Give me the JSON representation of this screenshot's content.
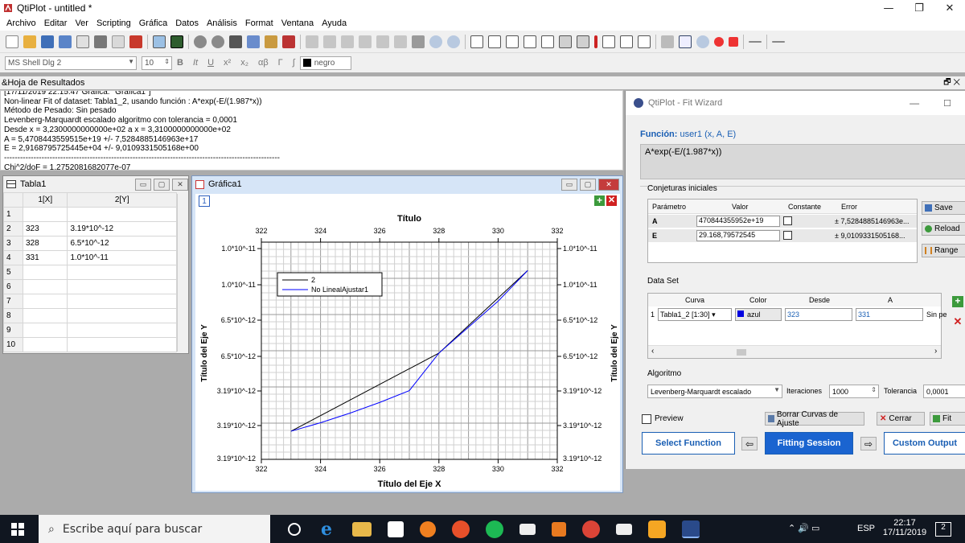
{
  "window": {
    "title": "QtiPlot - untitled *"
  },
  "menu": [
    "Archivo",
    "Editar",
    "Ver",
    "Scripting",
    "Gráfica",
    "Datos",
    "Análisis",
    "Format",
    "Ventana",
    "Ayuda"
  ],
  "format_bar": {
    "font": "MS Shell Dlg 2",
    "size": "10",
    "bold": "B",
    "italic": "It",
    "underline": "U",
    "superscript": "x²",
    "subscript": "x₂",
    "greek": "αβ",
    "color_label": "negro"
  },
  "results": {
    "header": "&Hoja de Resultados",
    "lines": [
      "[17/11/2019 22:15:47          Gráfica: ''Gráfica1'']",
      "Non-linear Fit of dataset: Tabla1_2, usando función : A*exp(-E/(1.987*x))",
      "Método de Pesado: Sin pesado",
      "Levenberg-Marquardt escalado algoritmo con tolerancia = 0,0001",
      "Desde x = 3,2300000000000e+02 a x = 3,3100000000000e+02",
      "A = 5,4708443559515e+19 +/- 7,5284885146963e+17",
      "E = 2,9168795725445e+04 +/- 9,0109331505168e+00",
      "-------------------------------------------------------------------------------------------------------",
      "Chi^2/doF = 1,2752081682077e-07"
    ]
  },
  "table": {
    "title": "Tabla1",
    "headers": [
      "1[X]",
      "2[Y]"
    ],
    "rows": [
      {
        "n": "1",
        "x": "",
        "y": ""
      },
      {
        "n": "2",
        "x": "323",
        "y": "3.19*10^-12"
      },
      {
        "n": "3",
        "x": "328",
        "y": "6.5*10^-12"
      },
      {
        "n": "4",
        "x": "331",
        "y": "1.0*10^-11"
      },
      {
        "n": "5",
        "x": "",
        "y": ""
      },
      {
        "n": "6",
        "x": "",
        "y": ""
      },
      {
        "n": "7",
        "x": "",
        "y": ""
      },
      {
        "n": "8",
        "x": "",
        "y": ""
      },
      {
        "n": "9",
        "x": "",
        "y": ""
      },
      {
        "n": "10",
        "x": "",
        "y": ""
      }
    ]
  },
  "graph": {
    "title": "Gráfica1",
    "layer": "1",
    "chart_title": "Título",
    "xlabel": "Título del Eje X",
    "ylabel": "Título del Eje Y",
    "x_ticks": [
      "322",
      "324",
      "326",
      "328",
      "330",
      "332"
    ],
    "y_ticks_left": [
      "1.0*10^-11",
      "1.0*10^-11",
      "6.5*10^-12",
      "6.5*10^-12",
      "3.19*10^-12",
      "3.19*10^-12",
      "3.19*10^-12"
    ],
    "legend": [
      "2",
      "No LinealAjustar1"
    ],
    "colors": {
      "data": "#000000",
      "fit": "#0000ff"
    }
  },
  "chart_data": {
    "type": "line",
    "title": "Título",
    "xlabel": "Título del Eje X",
    "ylabel": "Título del Eje Y",
    "xlim": [
      322,
      332
    ],
    "series": [
      {
        "name": "2",
        "x": [
          323,
          328,
          331
        ],
        "y": [
          3.19e-12,
          6.5e-12,
          1e-11
        ]
      },
      {
        "name": "No LinealAjustar1",
        "x": [
          323,
          324,
          325,
          326,
          327,
          328,
          329,
          330,
          331
        ],
        "y": [
          3.19e-12,
          3.55e-12,
          3.96e-12,
          4.41e-12,
          4.91e-12,
          6.5e-12,
          7.6e-12,
          8.7e-12,
          1e-11
        ]
      }
    ],
    "legend": "top-left"
  },
  "wizard": {
    "title": "QtiPlot - Fit Wizard",
    "funcion_label": "Función:",
    "funcion_name": "user1 (x, A, E)",
    "formula": "A*exp(-E/(1.987*x))",
    "conjeturas": "Conjeturas iniciales",
    "param_headers": [
      "Parámetro",
      "Valor",
      "Constante",
      "Error"
    ],
    "params": [
      {
        "name": "A",
        "value": "470844355952e+19",
        "error": "± 7,5284885146963e..."
      },
      {
        "name": "E",
        "value": "29.168,79572545",
        "error": "± 9,0109331505168..."
      }
    ],
    "save": "Save",
    "reload": "Reload",
    "range": "Range",
    "dataset": "Data Set",
    "ds_headers": [
      "Curva",
      "Color",
      "Desde",
      "A"
    ],
    "ds_row": {
      "n": "1",
      "curva": "Tabla1_2 [1:30]",
      "color": "azul",
      "desde": "323",
      "a": "331",
      "weight": "Sin pe"
    },
    "algoritmo": "Algoritmo",
    "algo_value": "Levenberg-Marquardt escalado",
    "iter_label": "Iteraciones",
    "iter_value": "1000",
    "tol_label": "Tolerancia",
    "tol_value": "0,0001",
    "preview": "Preview",
    "borrar": "Borrar Curvas de Ajuste",
    "cerrar": "Cerrar",
    "fit": "Fit",
    "select_function": "Select Function",
    "fitting_session": "Fitting Session",
    "custom_output": "Custom Output"
  },
  "taskbar": {
    "search": "Escribe aquí para buscar",
    "lang": "ESP",
    "time": "22:17",
    "date": "17/11/2019",
    "notif": "2"
  }
}
